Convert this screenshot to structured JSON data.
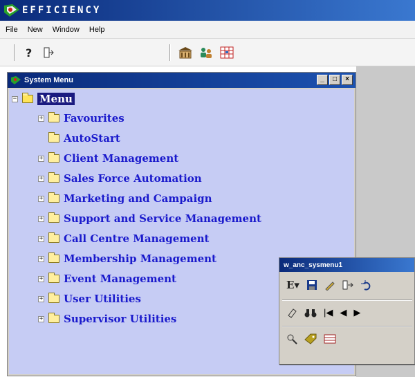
{
  "app": {
    "title": "EFFICIENCY"
  },
  "menubar": {
    "items": [
      "File",
      "New",
      "Window",
      "Help"
    ]
  },
  "toolbar": {
    "icons": [
      "help-icon",
      "exit-icon",
      "building-icon",
      "users-icon",
      "grid-icon"
    ]
  },
  "system_menu": {
    "title": "System Menu",
    "buttons": {
      "minimize": "_",
      "restore": "□",
      "close": "×"
    },
    "root": "Menu",
    "items": [
      {
        "label": "Favourites",
        "expandable": true
      },
      {
        "label": "AutoStart",
        "expandable": false
      },
      {
        "label": "Client Management",
        "expandable": true
      },
      {
        "label": "Sales Force Automation",
        "expandable": true
      },
      {
        "label": "Marketing and Campaign",
        "expandable": true
      },
      {
        "label": "Support and Service Management",
        "expandable": true
      },
      {
        "label": "Call Centre Management",
        "expandable": true
      },
      {
        "label": "Membership Management",
        "expandable": true
      },
      {
        "label": "Event Management",
        "expandable": true
      },
      {
        "label": "User Utilities",
        "expandable": true
      },
      {
        "label": "Supervisor Utilities",
        "expandable": true
      }
    ]
  },
  "palette": {
    "title": "w_anc_sysmenu1"
  }
}
